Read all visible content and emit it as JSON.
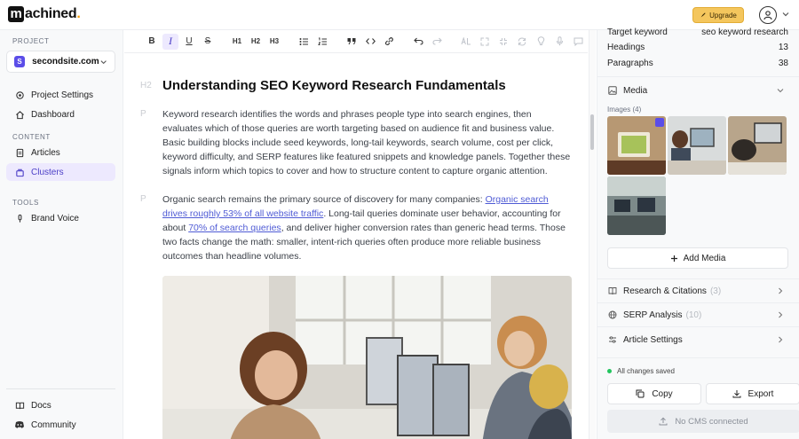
{
  "topbar": {
    "logo_initial": "m",
    "logo_text": "achined",
    "logo_dot": ".",
    "upgrade_label": "Upgrade"
  },
  "sidebar": {
    "project_label": "PROJECT",
    "project": {
      "badge": "S",
      "name": "secondsite.com"
    },
    "items_top": [
      {
        "label": "Project Settings",
        "icon": "gear-icon"
      },
      {
        "label": "Dashboard",
        "icon": "home-icon"
      }
    ],
    "content_label": "CONTENT",
    "content_items": [
      {
        "label": "Articles",
        "icon": "document-icon"
      },
      {
        "label": "Clusters",
        "icon": "layers-icon",
        "active": true
      }
    ],
    "tools_label": "TOOLS",
    "tools_items": [
      {
        "label": "Brand Voice",
        "icon": "microphone-icon"
      }
    ],
    "bottom_items": [
      {
        "label": "Docs",
        "icon": "book-icon"
      },
      {
        "label": "Community",
        "icon": "discord-icon"
      }
    ]
  },
  "toolbar": {
    "h1": "H1",
    "h2": "H2",
    "h3": "H3"
  },
  "editor": {
    "h2_tag": "H2",
    "heading": "Understanding SEO Keyword Research Fundamentals",
    "p_tag": "P",
    "p1": "Keyword research identifies the words and phrases people type into search engines, then evaluates which of those queries are worth targeting based on audience fit and business value. Basic building blocks include seed keywords, long-tail keywords, search volume, cost per click, keyword difficulty, and SERP features like featured snippets and knowledge panels. Together these signals inform which topics to cover and how to structure content to capture organic attention.",
    "p2_a": "Organic search remains the primary source of discovery for many companies: ",
    "p2_link1": "Organic search drives roughly 53% of all website traffic",
    "p2_b": ". Long-tail queries dominate user behavior, accounting for about ",
    "p2_link2": "70% of search queries",
    "p2_c": ", and deliver higher conversion rates than generic head terms. Those two facts change the math: smaller, intent-rich queries often produce more reliable business outcomes than headline volumes."
  },
  "rpanel": {
    "stats": [
      {
        "label": "Target keyword",
        "value": "seo keyword research"
      },
      {
        "label": "Headings",
        "value": "13"
      },
      {
        "label": "Paragraphs",
        "value": "38"
      }
    ],
    "media_title": "Media",
    "images_label": "Images (4)",
    "add_media": "Add Media",
    "sections": [
      {
        "label": "Research & Citations",
        "count": "(3)",
        "icon": "book-icon"
      },
      {
        "label": "SERP Analysis",
        "count": "(10)",
        "icon": "globe-icon"
      },
      {
        "label": "Article Settings",
        "count": "",
        "icon": "sliders-icon"
      }
    ],
    "saved_status": "All changes saved",
    "copy_label": "Copy",
    "export_label": "Export",
    "cms_label": "No CMS connected"
  },
  "colors": {
    "accent": "#5b4de8",
    "upgrade": "#f4c65d",
    "link": "#4f5bd5"
  }
}
